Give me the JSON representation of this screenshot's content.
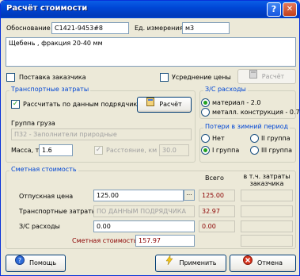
{
  "window": {
    "title": "Расчёт стоимости",
    "help_glyph": "?",
    "close_glyph": "✕"
  },
  "top": {
    "basis_label": "Обоснование",
    "basis_value": "С1421-9453#8",
    "unit_label": "Ед. измерения",
    "unit_value": "м3",
    "name_value": "Щебень  , фракция 20-40 мм",
    "customer_supply_label": "Поставка заказчика",
    "avg_price_label": "Усреднение цены",
    "calc_button": "Расчёт"
  },
  "transport": {
    "legend": "Транспортные затраты",
    "by_contractor_label": "Рассчитать по данным подрядчика",
    "by_contractor_checked": true,
    "calc_button": "Расчёт",
    "cargo_group_label": "Группа груза",
    "cargo_group_value": "П32 - Заполнители природные",
    "mass_label": "Масса, т",
    "mass_value": "1.6",
    "distance_label": "Расстояние, км",
    "distance_value": "30.0",
    "check_glyph": "✓"
  },
  "zs": {
    "legend": "З/С расходы",
    "options": [
      "материал - 2.0",
      "металл. конструкция - 0.75"
    ],
    "selected": 0
  },
  "winter": {
    "legend": "Потери в зимний период",
    "options": [
      "Нет",
      "II группа",
      "I группа",
      "III группа"
    ],
    "selected": 2
  },
  "estimate": {
    "legend": "Сметная стоимость",
    "col_total": "Всего",
    "col_customer": "в т.ч. затраты заказчика",
    "release_price_label": "Отпускная цена",
    "release_price_value": "125.00",
    "release_price_total": "125.00",
    "transport_label": "Транспортные затраты",
    "transport_value": "ПО ДАННЫМ ПОДРЯДЧИКА",
    "transport_total": "32.97",
    "zs_label": "З/С расходы",
    "zs_value": "0.00",
    "zs_total": "0.00",
    "estimate_label": "Сметная стоимость",
    "estimate_value": "157.97",
    "ellipsis": "..."
  },
  "footer": {
    "help": "Помощь",
    "apply": "Применить",
    "cancel": "Отмена"
  },
  "colors": {
    "title_blue": "#0046d5",
    "legend_blue": "#0046d5",
    "value_red": "#8b0000",
    "check_green": "#21a121"
  }
}
